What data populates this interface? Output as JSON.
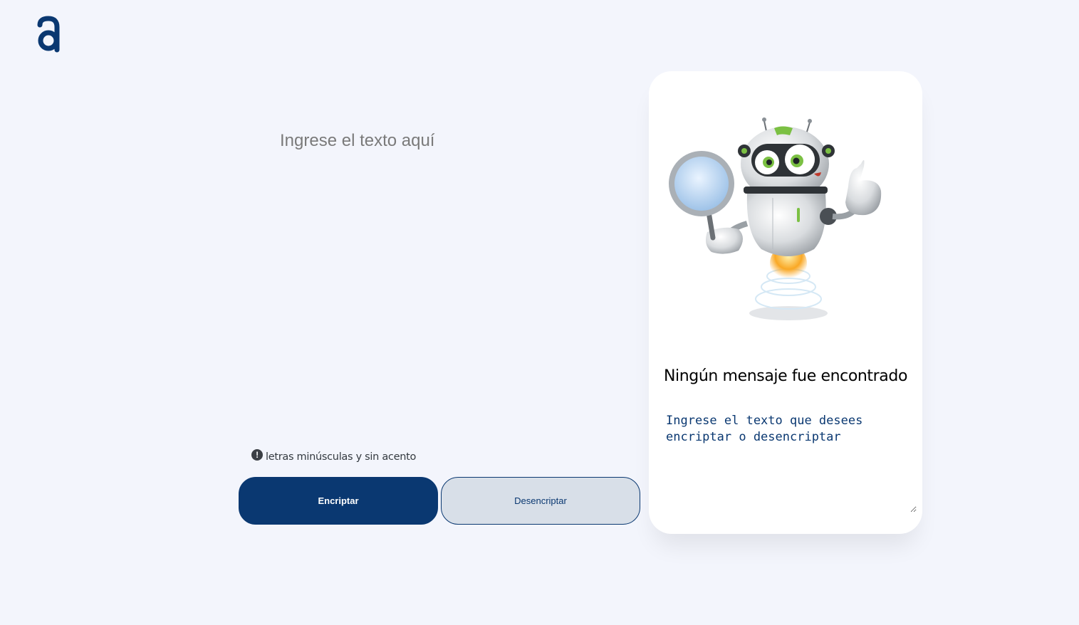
{
  "app": {
    "logo_icon": "alura-a-logo-icon",
    "brand_color": "#0a3871",
    "background_color": "#f3f5fc"
  },
  "input": {
    "placeholder": "Ingrese el texto aquí",
    "value": ""
  },
  "hint": {
    "icon": "exclamation-circle-icon",
    "text": "letras minúsculas y sin acento"
  },
  "buttons": {
    "encrypt_label": "Encriptar",
    "decrypt_label": "Desencriptar"
  },
  "result": {
    "illustration": "robot-magnifying-glass-illustration",
    "title": "Ningún mensaje fue encontrado",
    "placeholder": "Ingrese el texto que desees encriptar o desencriptar",
    "value": ""
  }
}
